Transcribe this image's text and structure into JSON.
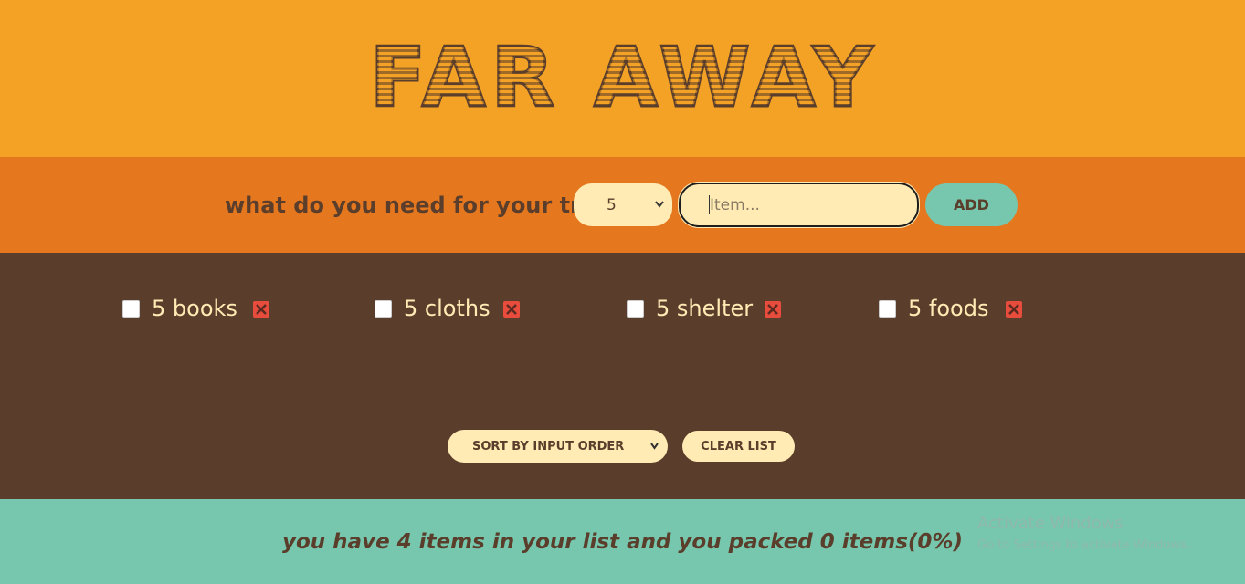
{
  "header": {
    "title": "FAR AWAY"
  },
  "form": {
    "prompt": "what do you need for your trip",
    "quantity_value": "5",
    "item_placeholder": "Item...",
    "add_label": "ADD"
  },
  "items": [
    {
      "label": "5 books",
      "packed": false
    },
    {
      "label": "5 cloths",
      "packed": false
    },
    {
      "label": "5 shelter",
      "packed": false
    },
    {
      "label": "5 foods",
      "packed": false
    }
  ],
  "actions": {
    "sort_selected": "SORT BY INPUT ORDER",
    "clear_label": "CLEAR LIST"
  },
  "stats": {
    "text": "you have 4 items in your list and you packed 0 items(0%)"
  },
  "watermark": {
    "title": "Activate Windows",
    "subtitle": "Go to Settings to activate Windows."
  },
  "colors": {
    "header_bg": "#f4a226",
    "form_bg": "#e5771f",
    "list_bg": "#5a3e2b",
    "stats_bg": "#76c7ad",
    "cream": "#ffebb3",
    "delete_red": "#e74c3c"
  }
}
